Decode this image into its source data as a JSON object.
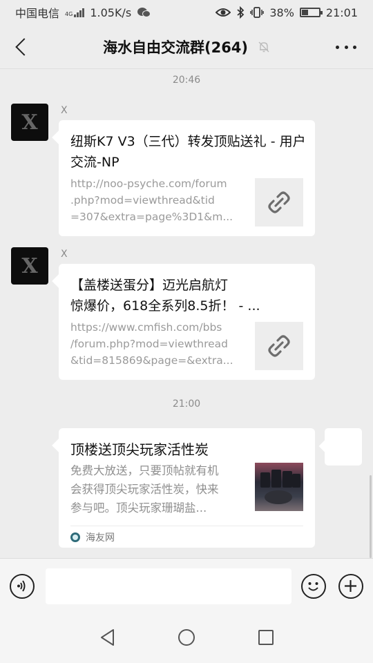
{
  "status_bar": {
    "carrier": "中国电信",
    "network_type": "4G",
    "speed": "1.05K/s",
    "battery_percent": "38%",
    "battery_level": 0.38,
    "time": "21:01",
    "icons": [
      "signal-icon",
      "wechat-icon",
      "eye-icon",
      "bluetooth-icon",
      "vibrate-icon",
      "battery-icon"
    ]
  },
  "header": {
    "title": "海水自由交流群(264)",
    "icons": [
      "back-arrow-icon",
      "mute-bell-icon",
      "more-dots-icon"
    ]
  },
  "messages": [
    {
      "type": "timestamp",
      "text": "20:46"
    },
    {
      "type": "link",
      "sender": "X",
      "avatar_letter": "X",
      "title": "纽斯K7 V3（三代）转发顶贴送礼 - 用户交流-NP",
      "url_lines": [
        "http://noo-psyche.com/forum",
        ".php?mod=viewthread&tid",
        "=307&extra=page%3D1&m..."
      ]
    },
    {
      "type": "link",
      "sender": "X",
      "avatar_letter": "X",
      "title_lines": [
        "【盖楼送蛋分】迈光启航灯",
        "惊爆价，618全系列8.5折！ - ..."
      ],
      "url_lines": [
        "https://www.cmfish.com/bbs",
        "/forum.php?mod=viewthread",
        "&tid=815869&page=&extra..."
      ]
    },
    {
      "type": "timestamp",
      "text": "21:00"
    },
    {
      "type": "article",
      "title": "顶楼送顶尖玩家活性炭",
      "desc_lines": [
        "免费大放送，只要顶帖就有机",
        "会获得顶尖玩家活性炭，快来",
        "参与吧。顶尖玩家珊瑚盐..."
      ],
      "source": "海友网"
    }
  ],
  "input_bar": {
    "icons": [
      "voice-icon",
      "emoji-icon",
      "plus-icon"
    ],
    "text": ""
  },
  "nav_bar": {
    "icons": [
      "nav-back-icon",
      "nav-home-icon",
      "nav-recent-icon"
    ]
  }
}
